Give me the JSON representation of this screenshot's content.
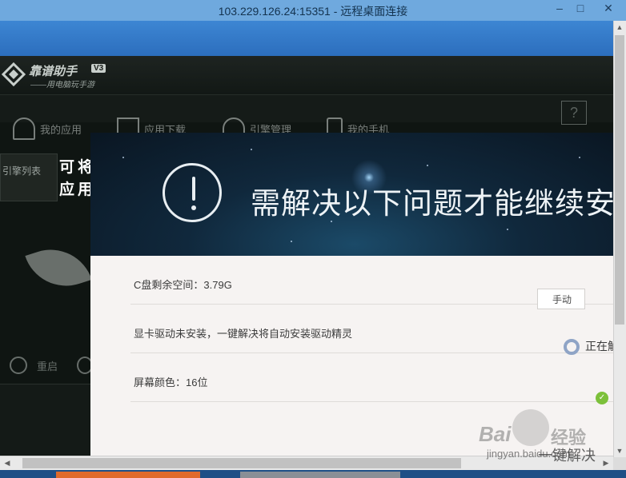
{
  "rdp": {
    "title": "103.229.126.24:15351 - 远程桌面连接",
    "minimize_glyph": "–",
    "maximize_glyph": "□",
    "close_glyph": "✕"
  },
  "app": {
    "name": "靠谱助手",
    "version": "V3",
    "slogan": "——用电脑玩手游",
    "help_glyph": "?",
    "nav": [
      {
        "label": "我的应用",
        "icon": "home-icon"
      },
      {
        "label": "应用下载",
        "icon": "download-icon"
      },
      {
        "label": "引擎管理",
        "icon": "android-icon"
      },
      {
        "label": "我的手机",
        "icon": "phone-icon"
      }
    ],
    "sidebar_label": "引擎列表",
    "side_text_line1": "可将",
    "side_text_line2": "应用",
    "restart_label": "重启"
  },
  "dialog": {
    "title": "需解决以下问题才能继续安装",
    "rows": [
      {
        "text": "C盘剩余空间：3.79G",
        "action": "手动"
      },
      {
        "text": "显卡驱动未安装，一键解决将自动安装驱动精灵",
        "action": "正在解决"
      },
      {
        "text": "屏幕颜色：16位",
        "status": "ok"
      }
    ]
  },
  "watermark": {
    "brand": "Bai",
    "brand_suffix": "经验",
    "url": "jingyan.baidu.com",
    "overlay_text": "一键解决"
  },
  "colors": {
    "titlebar": "#6fa9de",
    "dialog_body": "#f6f3f2",
    "ok_green": "#7cc03a"
  }
}
